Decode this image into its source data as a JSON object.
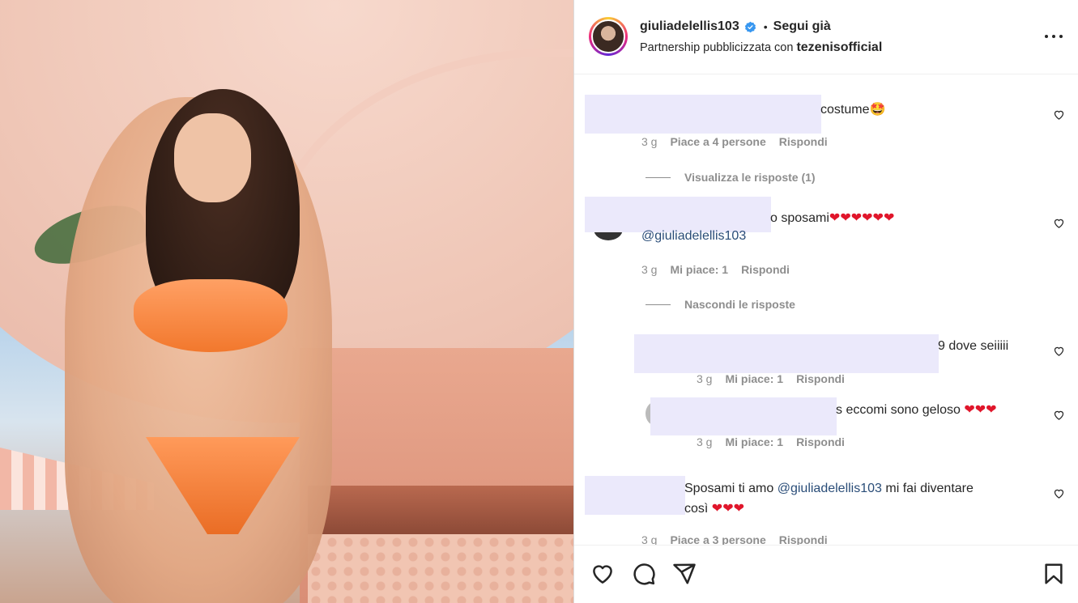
{
  "header": {
    "username": "giuliadelellis103",
    "separator": "•",
    "follow_label": "Segui già",
    "partnership_prefix": "Partnership pubblicizzata con",
    "partner": "tezenisofficial"
  },
  "comments": [
    {
      "text": "costume",
      "emoji": "🤩",
      "time": "3 g",
      "likes": "Piace a 4 persone",
      "reply": "Rispondi",
      "toggle": "Visualizza le risposte (1)"
    },
    {
      "text": "o sposami",
      "hearts": "❤❤❤❤❤❤",
      "mention": "@giuliadelellis103",
      "time": "3 g",
      "likes": "Mi piace: 1",
      "reply": "Rispondi",
      "toggle": "Nascondi le risposte"
    },
    {
      "text": "9 dove seiiiii",
      "time": "3 g",
      "likes": "Mi piace: 1",
      "reply": "Rispondi"
    },
    {
      "text": "s eccomi sono geloso",
      "hearts": "❤❤❤",
      "time": "3 g",
      "likes": "Mi piace: 1",
      "reply": "Rispondi"
    },
    {
      "text_prefix": "Sposami ti amo",
      "mention": "@giuliadelellis103",
      "text_suffix": "mi fai diventare",
      "line2": "così",
      "hearts": "❤❤❤",
      "time": "3 g",
      "likes": "Piace a 3 persone",
      "reply": "Rispondi"
    }
  ],
  "icons": {
    "verified": "verified-badge-icon",
    "more": "more-options-icon",
    "like": "heart-icon",
    "comment": "comment-icon",
    "share": "share-icon",
    "save": "bookmark-icon"
  },
  "colors": {
    "verified": "#3897f0",
    "text": "#262626",
    "secondary": "#8e8e8e",
    "mention": "#2a4d78",
    "redaction": "#ebe9fb"
  }
}
